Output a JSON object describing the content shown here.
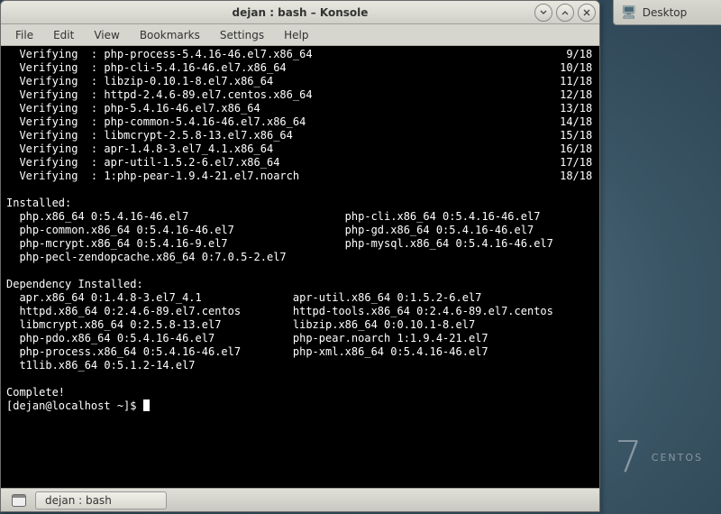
{
  "desktop_button": "Desktop",
  "centos": {
    "number": "7",
    "label": "CENTOS"
  },
  "window": {
    "title": "dejan : bash – Konsole",
    "menubar": [
      "File",
      "Edit",
      "View",
      "Bookmarks",
      "Settings",
      "Help"
    ],
    "task_label": "dejan : bash"
  },
  "terminal": {
    "verifying": [
      {
        "pkg": "php-process-5.4.16-46.el7.x86_64",
        "count": "9/18"
      },
      {
        "pkg": "php-cli-5.4.16-46.el7.x86_64",
        "count": "10/18"
      },
      {
        "pkg": "libzip-0.10.1-8.el7.x86_64",
        "count": "11/18"
      },
      {
        "pkg": "httpd-2.4.6-89.el7.centos.x86_64",
        "count": "12/18"
      },
      {
        "pkg": "php-5.4.16-46.el7.x86_64",
        "count": "13/18"
      },
      {
        "pkg": "php-common-5.4.16-46.el7.x86_64",
        "count": "14/18"
      },
      {
        "pkg": "libmcrypt-2.5.8-13.el7.x86_64",
        "count": "15/18"
      },
      {
        "pkg": "apr-1.4.8-3.el7_4.1.x86_64",
        "count": "16/18"
      },
      {
        "pkg": "apr-util-1.5.2-6.el7.x86_64",
        "count": "17/18"
      },
      {
        "pkg": "1:php-pear-1.9.4-21.el7.noarch",
        "count": "18/18"
      }
    ],
    "installed_header": "Installed:",
    "installed": [
      [
        "php.x86_64 0:5.4.16-46.el7",
        "php-cli.x86_64 0:5.4.16-46.el7"
      ],
      [
        "php-common.x86_64 0:5.4.16-46.el7",
        "php-gd.x86_64 0:5.4.16-46.el7"
      ],
      [
        "php-mcrypt.x86_64 0:5.4.16-9.el7",
        "php-mysql.x86_64 0:5.4.16-46.el7"
      ],
      [
        "php-pecl-zendopcache.x86_64 0:7.0.5-2.el7",
        ""
      ]
    ],
    "dep_header": "Dependency Installed:",
    "deps": [
      [
        "apr.x86_64 0:1.4.8-3.el7_4.1",
        "apr-util.x86_64 0:1.5.2-6.el7"
      ],
      [
        "httpd.x86_64 0:2.4.6-89.el7.centos",
        "httpd-tools.x86_64 0:2.4.6-89.el7.centos"
      ],
      [
        "libmcrypt.x86_64 0:2.5.8-13.el7",
        "libzip.x86_64 0:0.10.1-8.el7"
      ],
      [
        "php-pdo.x86_64 0:5.4.16-46.el7",
        "php-pear.noarch 1:1.9.4-21.el7"
      ],
      [
        "php-process.x86_64 0:5.4.16-46.el7",
        "php-xml.x86_64 0:5.4.16-46.el7"
      ],
      [
        "t1lib.x86_64 0:5.1.2-14.el7",
        ""
      ]
    ],
    "complete": "Complete!",
    "prompt": "[dejan@localhost ~]$ "
  }
}
